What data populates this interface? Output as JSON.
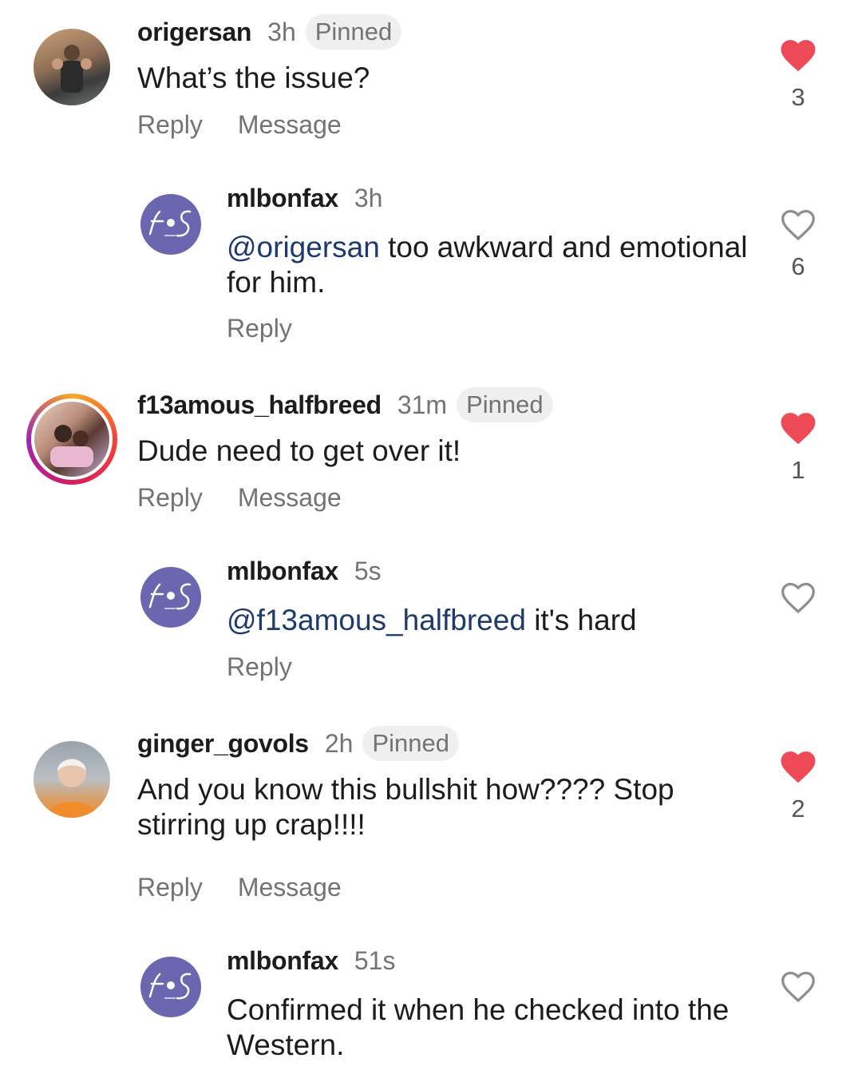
{
  "colors": {
    "like_red": "#ed4956",
    "fos_purple": "#6b66b0",
    "mention_blue": "#1d3a6e"
  },
  "comments": [
    {
      "username": "origersan",
      "time": "3h",
      "pinned": "Pinned",
      "text": "What’s the issue?",
      "reply": "Reply",
      "message": "Message",
      "liked": true,
      "likes": "3",
      "avatar_icon": "user-photo-icon"
    },
    {
      "username": "mlbonfax",
      "time": "3h",
      "mention": "@origersan",
      "text": " too awkward and emotional for him.",
      "reply": "Reply",
      "liked": false,
      "likes": "6",
      "avatar_text": "FS"
    },
    {
      "username": "f13amous_halfbreed",
      "time": "31m",
      "pinned": "Pinned",
      "text": "Dude need to get over it!",
      "reply": "Reply",
      "message": "Message",
      "liked": true,
      "likes": "1",
      "avatar_icon": "user-photo-icon"
    },
    {
      "username": "mlbonfax",
      "time": "5s",
      "mention": "@f13amous_halfbreed",
      "text": " it's hard",
      "reply": "Reply",
      "liked": false,
      "avatar_text": "FS"
    },
    {
      "username": "ginger_govols",
      "time": "2h",
      "pinned": "Pinned",
      "text": "And you know this bullshit how???? Stop stirring up crap!!!!",
      "reply": "Reply",
      "message": "Message",
      "liked": true,
      "likes": "2",
      "avatar_icon": "user-photo-icon"
    },
    {
      "username": "mlbonfax",
      "time": "51s",
      "text": "Confirmed it when he checked into the Western.",
      "liked": false,
      "avatar_text": "FS"
    }
  ]
}
